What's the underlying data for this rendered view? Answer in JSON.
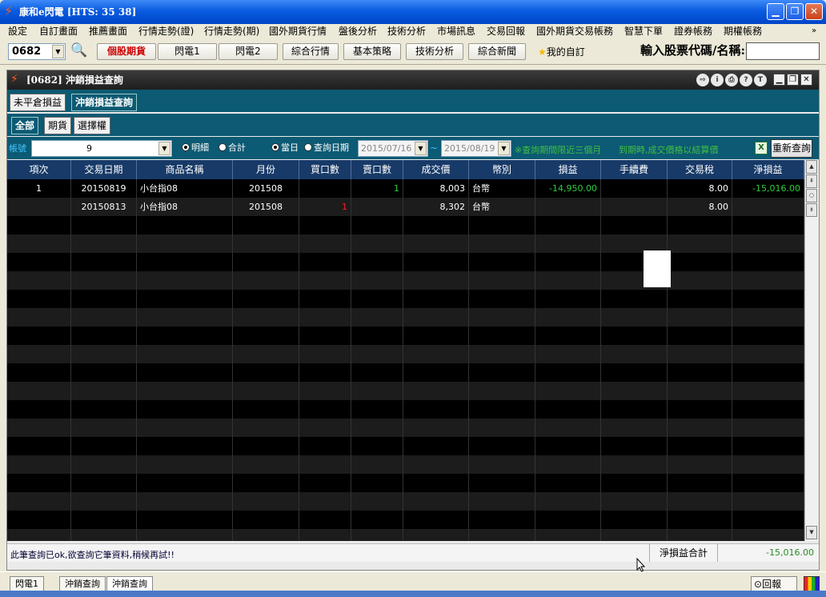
{
  "window": {
    "title": "康和e閃電 [HTS: 35 38]"
  },
  "menu": [
    "設定",
    "自訂畫面",
    "推薦畫面",
    "行情走勢(證)",
    "行情走勢(期)",
    "國外期貨行情",
    "盤後分析",
    "技術分析",
    "市場訊息",
    "交易回報",
    "國外期貨交易帳務",
    "智慧下單",
    "證券帳務",
    "期權帳務"
  ],
  "toolbar": {
    "code": "0682",
    "buttons": [
      "個股期貨",
      "閃電1",
      "閃電2",
      "綜合行情",
      "基本策略",
      "技術分析",
      "綜合新聞"
    ],
    "my_custom": "我的自訂",
    "stock_input_label": "輸入股票代碼/名稱:",
    "stock_input_value": ""
  },
  "panel": {
    "title": "[0682] 沖銷損益查詢",
    "tabs1": [
      "未平倉損益",
      "沖銷損益查詢"
    ],
    "tabs2": [
      "全部",
      "期貨",
      "選擇權"
    ],
    "filter": {
      "account_label": "帳號",
      "account_value": "9",
      "mode_detail": "明細",
      "mode_total": "合計",
      "day_today": "當日",
      "day_query": "查詢日期",
      "date_from": "2015/07/16",
      "tilde": "~",
      "date_to": "2015/08/19",
      "notice1": "※查詢期間限近三個月",
      "notice2": "到期時,成交價格以結算價",
      "requery": "重新查詢"
    },
    "columns": [
      "項次",
      "交易日期",
      "商品名稱",
      "月份",
      "買口數",
      "賣口數",
      "成交價",
      "幣別",
      "損益",
      "手續費",
      "交易稅",
      "淨損益"
    ],
    "rows": [
      {
        "idx": "1",
        "date": "20150819",
        "name": "小台指08",
        "month": "201508",
        "buy": "",
        "sell": "1",
        "price": "8,003",
        "currency": "台幣",
        "pl": "-14,950.00",
        "fee": "",
        "tax": "8.00",
        "net": "-15,016.00"
      },
      {
        "idx": "",
        "date": "20150813",
        "name": "小台指08",
        "month": "201508",
        "buy": "1",
        "sell": "",
        "price": "8,302",
        "currency": "台幣",
        "pl": "",
        "fee": "",
        "tax": "8.00",
        "net": ""
      }
    ],
    "status": {
      "message": "此筆查詢已ok,欲查詢它筆資料,稍候再試!!",
      "net_total_label": "淨損益合計",
      "net_total_value": "-15,016.00"
    }
  },
  "taskbar": {
    "items": [
      "閃電1",
      "沖銷查詢",
      "沖銷查詢"
    ],
    "report": "回報"
  },
  "colors": {
    "grid_bg": "#000000",
    "row_alt": "#1c1c1c",
    "header_bg": "#183a68",
    "teal": "#0c5a73",
    "green": "#2ecc40",
    "red": "#ff2020"
  }
}
